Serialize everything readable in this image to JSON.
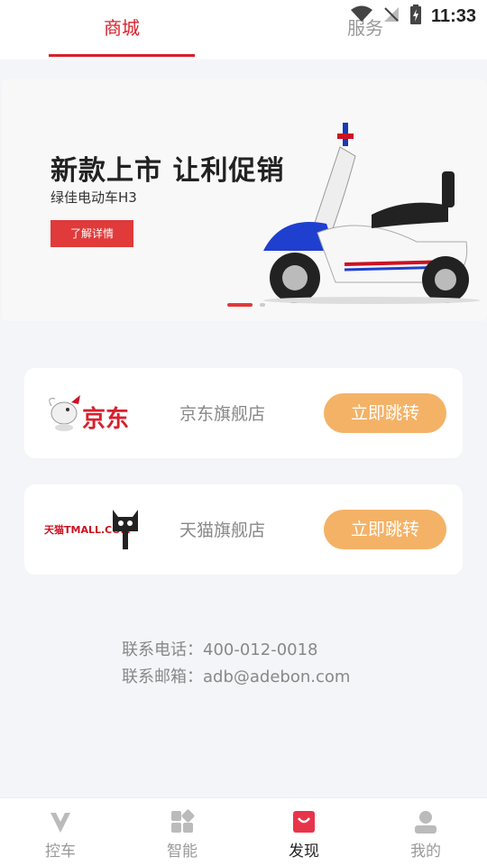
{
  "status_bar": {
    "time": "11:33"
  },
  "tabs": [
    {
      "label": "商城",
      "active": true
    },
    {
      "label": "服务",
      "active": false
    }
  ],
  "banner": {
    "title": "新款上市 让利促销",
    "subtitle": "绿佳电动车H3",
    "button_label": "了解详情"
  },
  "stores": [
    {
      "logo_text": "京东",
      "name": "京东旗舰店",
      "button_label": "立即跳转"
    },
    {
      "logo_text": "天猫TMALL.COM",
      "name": "天猫旗舰店",
      "button_label": "立即跳转"
    }
  ],
  "contact": {
    "phone_label": "联系电话：400-012-0018",
    "email_label": "联系邮箱：adb@adebon.com"
  },
  "bottom_nav": [
    {
      "label": "控车",
      "icon": "scooter-front-icon",
      "active": false
    },
    {
      "label": "智能",
      "icon": "grid-apps-icon",
      "active": false
    },
    {
      "label": "发现",
      "icon": "shopping-bag-icon",
      "active": true
    },
    {
      "label": "我的",
      "icon": "user-icon",
      "active": false
    }
  ],
  "colors": {
    "accent": "#d8202c",
    "button_orange": "#f4b266",
    "background": "#f4f5f8"
  }
}
